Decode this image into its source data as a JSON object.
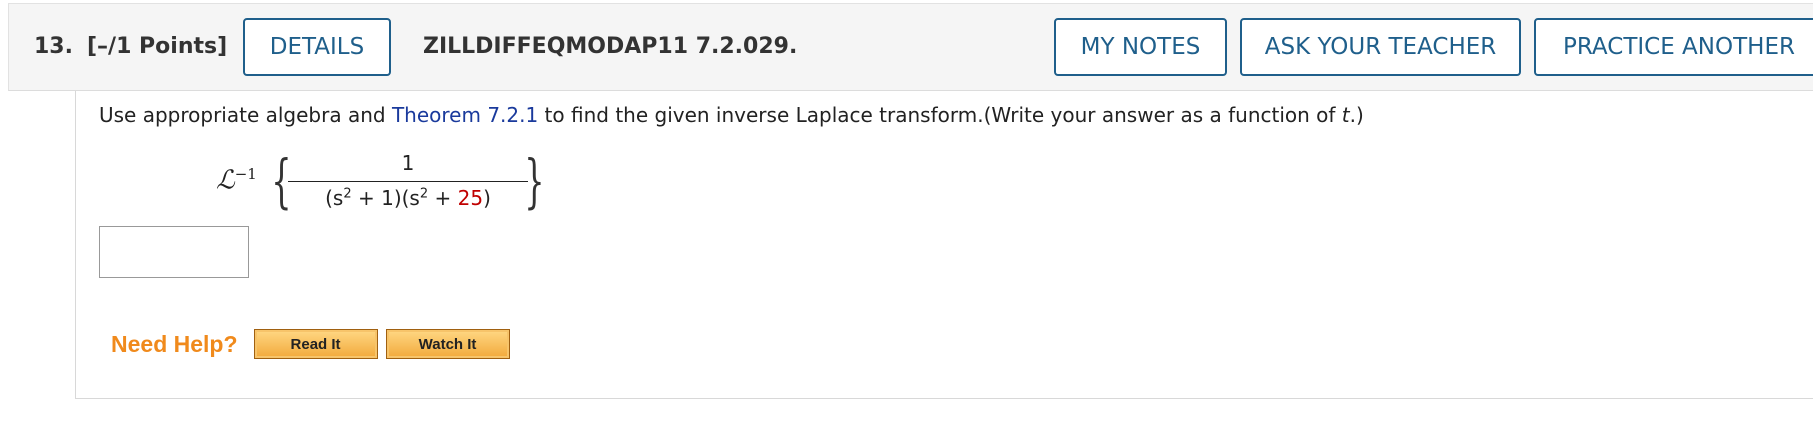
{
  "header": {
    "question_number": "13.",
    "points": "[–/1 Points]",
    "details_label": "DETAILS",
    "question_id": "ZILLDIFFEQMODAP11 7.2.029.",
    "my_notes_label": "MY NOTES",
    "ask_teacher_label": "ASK YOUR TEACHER",
    "practice_label": "PRACTICE ANOTHER"
  },
  "question": {
    "prompt_start": "Use appropriate algebra and ",
    "theorem_link": "Theorem 7.2.1",
    "prompt_mid": " to find the given inverse Laplace transform.(Write your answer as a function of ",
    "prompt_var": "t",
    "prompt_end": ".)",
    "laplace_symbol": "ℒ",
    "laplace_exp": "−1",
    "brace_left": "{",
    "brace_right": "}",
    "numerator": "1",
    "den_part1": "(s",
    "den_sup1": "2",
    "den_part2": " + 1)(s",
    "den_sup2": "2",
    "den_part3": " + ",
    "den_red": "25",
    "den_part4": ")"
  },
  "answer": {
    "value": ""
  },
  "help": {
    "label": "Need Help?",
    "read_label": "Read It",
    "watch_label": "Watch It"
  },
  "colors": {
    "button_border": "#1f5f8b",
    "link": "#1a3a9c",
    "highlight_red": "#c00000",
    "help_orange": "#f08a1c"
  }
}
